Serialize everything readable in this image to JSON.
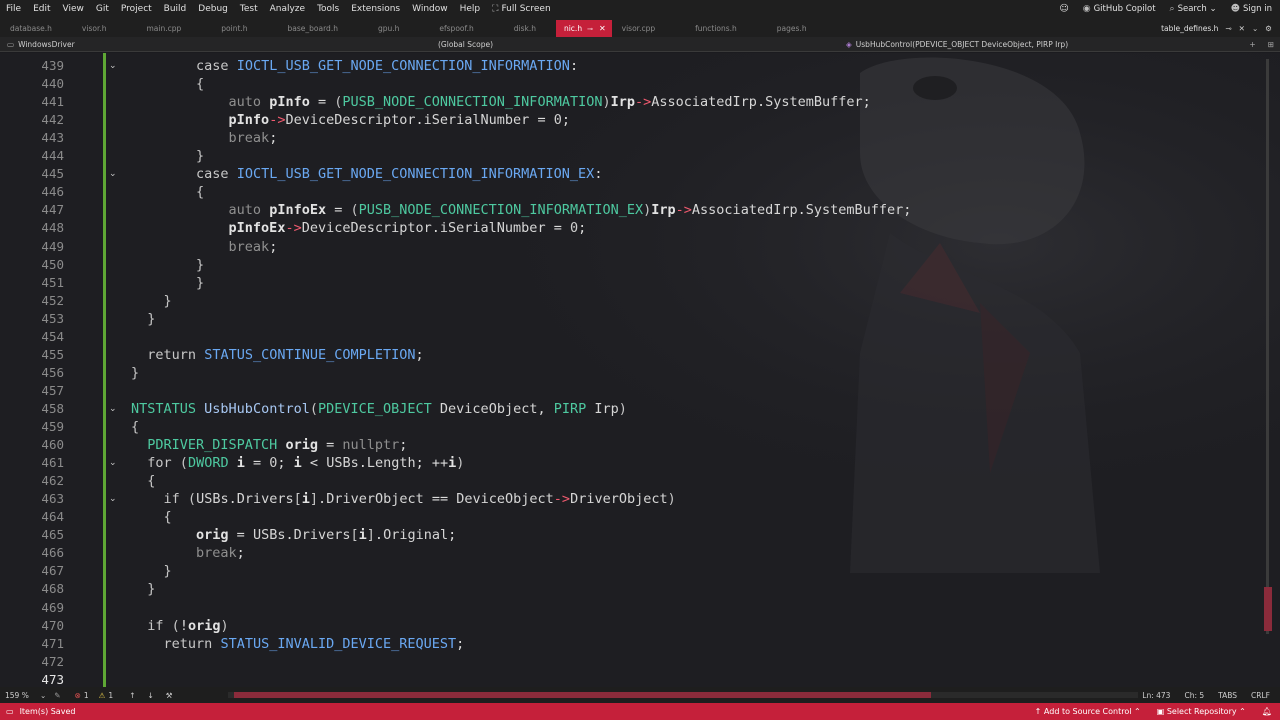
{
  "menu": {
    "items": [
      "File",
      "Edit",
      "View",
      "Git",
      "Project",
      "Build",
      "Debug",
      "Test",
      "Analyze",
      "Tools",
      "Extensions",
      "Window",
      "Help"
    ],
    "fullscreen_label": "Full Screen",
    "copilot_label": "GitHub Copilot",
    "search_label": "Search",
    "signin_label": "Sign in"
  },
  "tabs": {
    "items": [
      "database.h",
      "visor.h",
      "main.cpp",
      "point.h",
      "base_board.h",
      "gpu.h",
      "efspoof.h",
      "disk.h"
    ],
    "active": "nic.h",
    "after": [
      "visor.cpp",
      "functions.h",
      "pages.h"
    ],
    "right_tab": "table_defines.h"
  },
  "navbar": {
    "project": "WindowsDriver",
    "scope": "(Global Scope)",
    "member": "UsbHubControl(PDEVICE_OBJECT DeviceObject, PIRP Irp)"
  },
  "code": {
    "lines": [
      {
        "n": "439",
        "fold": true,
        "html": "        <span class='kw'>case</span> <span class='mac'>IOCTL_USB_GET_NODE_CONNECTION_INFORMATION</span>:"
      },
      {
        "n": "440",
        "html": "        <span class='paren'>{</span>"
      },
      {
        "n": "441",
        "html": "            <span class='kwd'>auto</span> <span class='var'>pInfo</span> = <span class='paren'>(</span><span class='typ'>PUSB_NODE_CONNECTION_INFORMATION</span><span class='paren'>)</span><span class='var'>Irp</span><span class='red'>-></span><span class='mem'>AssociatedIrp</span>.<span class='mem'>SystemBuffer</span>;"
      },
      {
        "n": "442",
        "html": "            <span class='var'>pInfo</span><span class='red'>-></span><span class='mem'>DeviceDescriptor</span>.<span class='mem'>iSerialNumber</span> = <span class='num'>0</span>;"
      },
      {
        "n": "443",
        "html": "            <span class='kwd'>break</span>;"
      },
      {
        "n": "444",
        "html": "        <span class='paren'>}</span>"
      },
      {
        "n": "445",
        "fold": true,
        "html": "        <span class='kw'>case</span> <span class='mac'>IOCTL_USB_GET_NODE_CONNECTION_INFORMATION_EX</span>:"
      },
      {
        "n": "446",
        "html": "        <span class='paren'>{</span>"
      },
      {
        "n": "447",
        "html": "            <span class='kwd'>auto</span> <span class='var'>pInfoEx</span> = <span class='paren'>(</span><span class='typ'>PUSB_NODE_CONNECTION_INFORMATION_EX</span><span class='paren'>)</span><span class='var'>Irp</span><span class='red'>-></span><span class='mem'>AssociatedIrp</span>.<span class='mem'>SystemBuffer</span>;"
      },
      {
        "n": "448",
        "html": "            <span class='var'>pInfoEx</span><span class='red'>-></span><span class='mem'>DeviceDescriptor</span>.<span class='mem'>iSerialNumber</span> = <span class='num'>0</span>;"
      },
      {
        "n": "449",
        "html": "            <span class='kwd'>break</span>;"
      },
      {
        "n": "450",
        "html": "        <span class='paren'>}</span>"
      },
      {
        "n": "451",
        "html": "        <span class='paren'>}</span>"
      },
      {
        "n": "452",
        "html": "    <span class='paren'>}</span>"
      },
      {
        "n": "453",
        "html": "  <span class='paren'>}</span>"
      },
      {
        "n": "454",
        "html": ""
      },
      {
        "n": "455",
        "html": "  <span class='kw'>return</span> <span class='mac'>STATUS_CONTINUE_COMPLETION</span>;"
      },
      {
        "n": "456",
        "html": "<span class='paren'>}</span>"
      },
      {
        "n": "457",
        "html": ""
      },
      {
        "n": "458",
        "fold": true,
        "html": "<span class='typ'>NTSTATUS</span> <span class='fn'>UsbHubControl</span><span class='paren'>(</span><span class='typ'>PDEVICE_OBJECT</span> <span class='mem'>DeviceObject</span>, <span class='typ'>PIRP</span> <span class='mem'>Irp</span><span class='paren'>)</span>"
      },
      {
        "n": "459",
        "html": "<span class='paren'>{</span>"
      },
      {
        "n": "460",
        "html": "  <span class='typ'>PDRIVER_DISPATCH</span> <span class='var'>orig</span> = <span class='kwd'>nullptr</span>;"
      },
      {
        "n": "461",
        "fold": true,
        "html": "  <span class='kw'>for</span> <span class='paren'>(</span><span class='typ'>DWORD</span> <span class='var'>i</span> = <span class='num'>0</span>; <span class='var'>i</span> &lt; <span class='mem'>USBs</span>.<span class='mem'>Length</span>; ++<span class='var'>i</span><span class='paren'>)</span>"
      },
      {
        "n": "462",
        "html": "  <span class='paren'>{</span>"
      },
      {
        "n": "463",
        "fold": true,
        "html": "    <span class='kw'>if</span> <span class='paren'>(</span><span class='mem'>USBs</span>.<span class='mem'>Drivers</span><span class='paren'>[</span><span class='var'>i</span><span class='paren'>]</span>.<span class='mem'>DriverObject</span> == <span class='mem'>DeviceObject</span><span class='red'>-></span><span class='mem'>DriverObject</span><span class='paren'>)</span>"
      },
      {
        "n": "464",
        "html": "    <span class='paren'>{</span>"
      },
      {
        "n": "465",
        "html": "        <span class='var'>orig</span> = <span class='mem'>USBs</span>.<span class='mem'>Drivers</span><span class='paren'>[</span><span class='var'>i</span><span class='paren'>]</span>.<span class='mem'>Original</span>;"
      },
      {
        "n": "466",
        "html": "        <span class='kwd'>break</span>;"
      },
      {
        "n": "467",
        "html": "    <span class='paren'>}</span>"
      },
      {
        "n": "468",
        "html": "  <span class='paren'>}</span>"
      },
      {
        "n": "469",
        "html": ""
      },
      {
        "n": "470",
        "html": "  <span class='kw'>if</span> <span class='paren'>(</span>!<span class='var'>orig</span><span class='paren'>)</span>"
      },
      {
        "n": "471",
        "html": "    <span class='kw'>return</span> <span class='mac'>STATUS_INVALID_DEVICE_REQUEST</span>;"
      },
      {
        "n": "472",
        "html": ""
      },
      {
        "n": "473",
        "cur": true,
        "html": ""
      }
    ]
  },
  "editor_status": {
    "zoom": "159 %",
    "errors": "1",
    "warnings": "1",
    "ln": "Ln: 473",
    "ch": "Ch: 5",
    "tabs": "TABS",
    "eol": "CRLF"
  },
  "statusbar": {
    "message": "Item(s) Saved",
    "add_source": "Add to Source Control",
    "select_repo": "Select Repository"
  },
  "colors": {
    "accent": "#c5203a",
    "changed_bar": "#5fa835",
    "macro": "#6aa8f2",
    "type": "#4ec9a0"
  }
}
